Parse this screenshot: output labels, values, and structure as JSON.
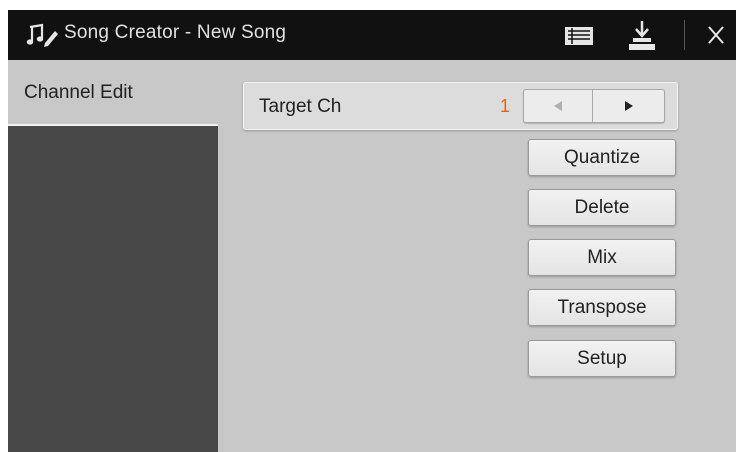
{
  "titlebar": {
    "app_icon": "music-note-edit-icon",
    "title": "Song Creator - New Song",
    "buttons": [
      "list-icon",
      "save-download-icon",
      "close-icon"
    ]
  },
  "sidebar": {
    "tabs": [
      {
        "label": "Channel Edit",
        "active": true
      }
    ]
  },
  "main": {
    "target": {
      "label": "Target Ch",
      "value": "1",
      "value_color": "#e0641a"
    },
    "actions": {
      "quantize": "Quantize",
      "delete": "Delete",
      "mix": "Mix",
      "transpose": "Transpose",
      "setup": "Setup"
    }
  },
  "colors": {
    "titlebar_bg": "#111111",
    "panel_bg": "#c8c8c8",
    "sidebar_bg": "#484848"
  }
}
